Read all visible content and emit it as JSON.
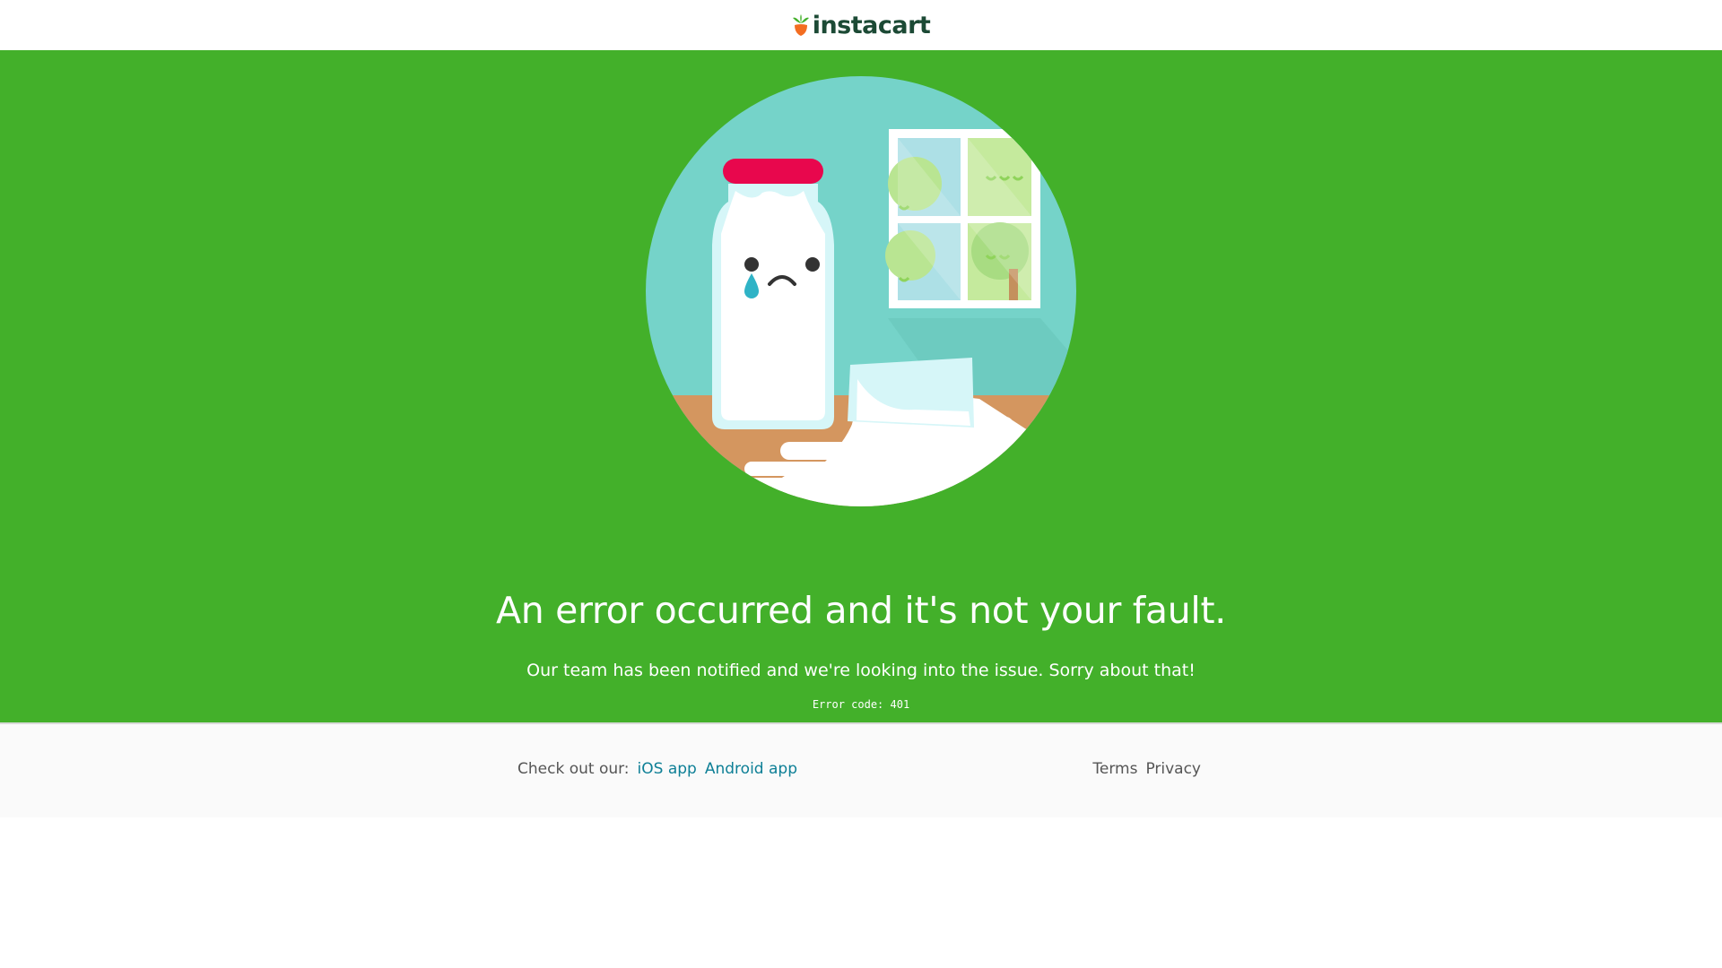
{
  "header": {
    "brand": "instacart"
  },
  "hero": {
    "headline": "An error occurred and it's not your fault.",
    "subtext": "Our team has been notified and we're looking into the issue. Sorry about that!",
    "error_code": "Error code: 401",
    "background_color": "#43b02a",
    "illustration": "sad-milk-bottle-spilled-glass-illustration"
  },
  "footer": {
    "check_out_label": "Check out our:",
    "ios_app": "iOS app",
    "android_app": "Android app",
    "terms": "Terms",
    "privacy": "Privacy"
  },
  "colors": {
    "brand_text": "#1c4a35",
    "carrot_leaf": "#43b02a",
    "carrot": "#f36d21",
    "link": "#0d7f96"
  }
}
